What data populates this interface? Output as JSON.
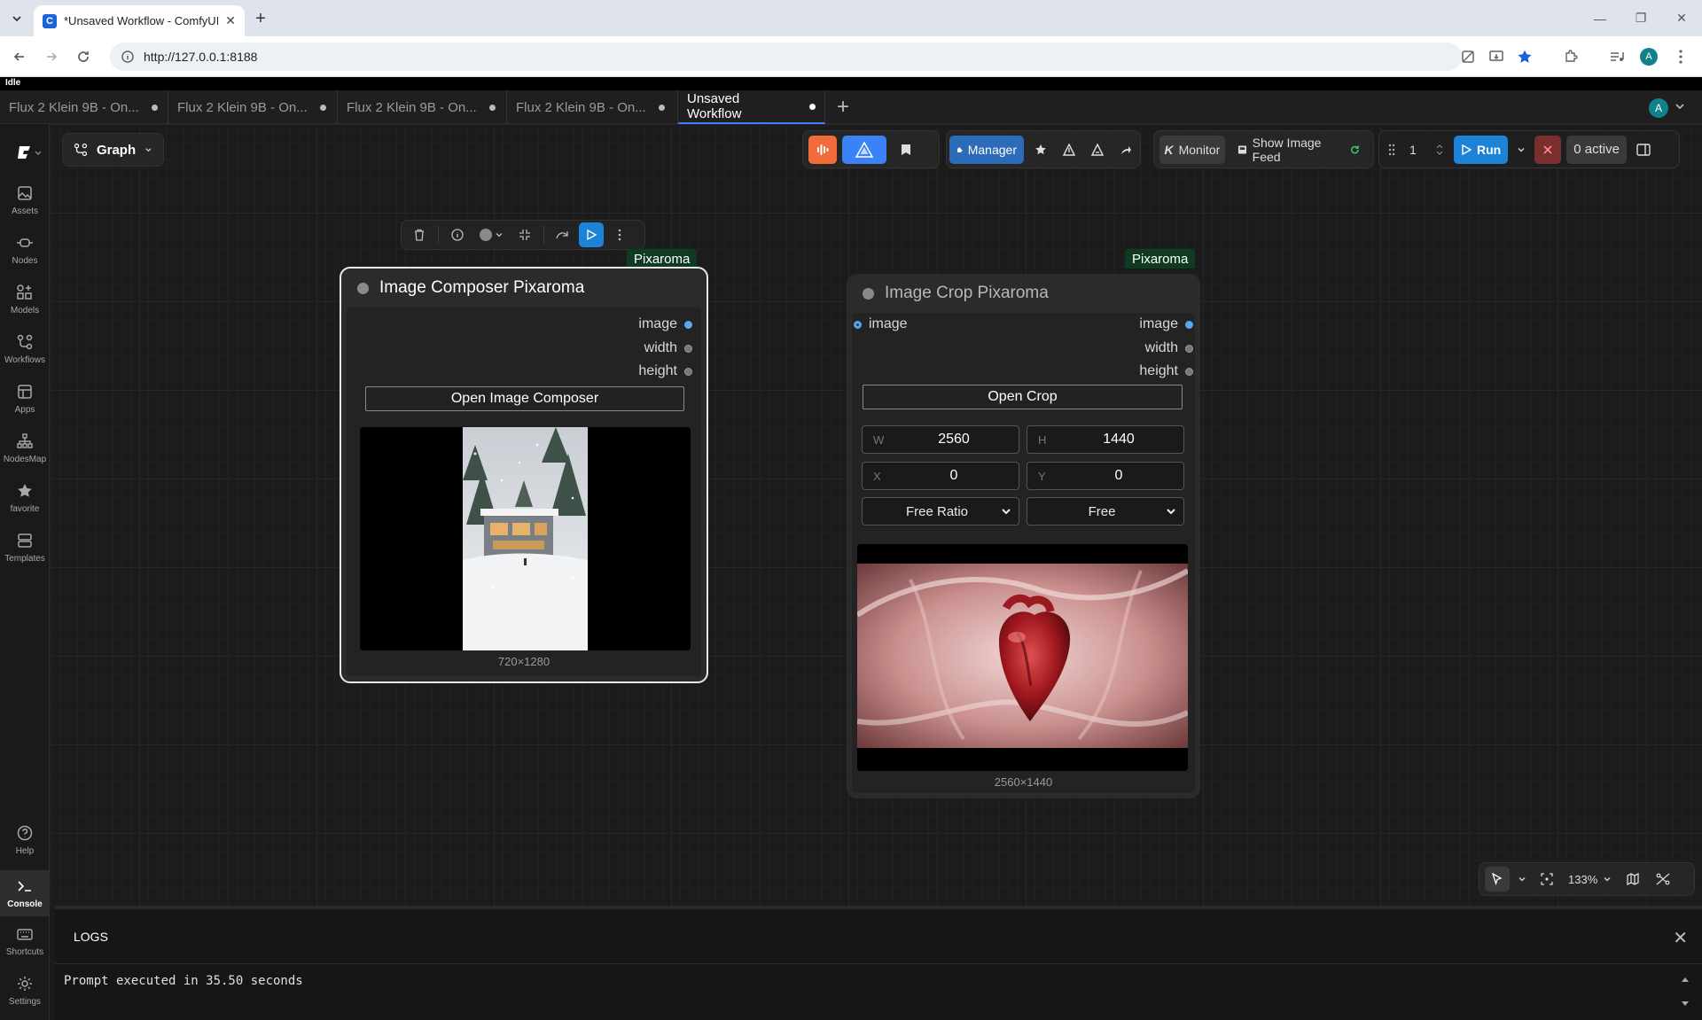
{
  "browser": {
    "tab_title": "*Unsaved Workflow - ComfyUI",
    "favicon_letter": "C",
    "url": "http://127.0.0.1:8188",
    "profile_initial": "A"
  },
  "status": {
    "text": "Idle"
  },
  "workflow_tabs": [
    {
      "label": "Flux 2 Klein 9B - On...",
      "active": false
    },
    {
      "label": "Flux 2 Klein 9B - On...",
      "active": false
    },
    {
      "label": "Flux 2 Klein 9B - On...",
      "active": false
    },
    {
      "label": "Flux 2 Klein 9B - On...",
      "active": false
    },
    {
      "label": "Unsaved Workflow",
      "active": true
    }
  ],
  "user_initial": "A",
  "sidebar": {
    "items": [
      {
        "label": "Assets",
        "icon": "image-icon"
      },
      {
        "label": "Nodes",
        "icon": "node-icon"
      },
      {
        "label": "Models",
        "icon": "models-icon"
      },
      {
        "label": "Workflows",
        "icon": "workflow-icon"
      },
      {
        "label": "Apps",
        "icon": "apps-icon"
      },
      {
        "label": "NodesMap",
        "icon": "nodesmap-icon"
      },
      {
        "label": "favorite",
        "icon": "star-icon"
      },
      {
        "label": "Templates",
        "icon": "templates-icon"
      }
    ],
    "bottom": [
      {
        "label": "Help",
        "icon": "help-icon"
      },
      {
        "label": "Console",
        "icon": "terminal-icon"
      },
      {
        "label": "Shortcuts",
        "icon": "keyboard-icon"
      },
      {
        "label": "Settings",
        "icon": "gear-icon"
      }
    ]
  },
  "graph_menu": {
    "label": "Graph"
  },
  "topbar": {
    "manager_label": "Manager",
    "monitor_label": "Monitor",
    "monitor_prefix": "K",
    "image_feed_label": "Show Image Feed",
    "queue_count": "1",
    "run_label": "Run",
    "active_label": "0 active"
  },
  "nodes": {
    "composer": {
      "title": "Image Composer Pixaroma",
      "badge": "Pixaroma",
      "outputs": [
        "image",
        "width",
        "height"
      ],
      "button": "Open Image Composer",
      "caption": "720×1280"
    },
    "crop": {
      "title": "Image Crop Pixaroma",
      "badge": "Pixaroma",
      "input": "image",
      "outputs": [
        "image",
        "width",
        "height"
      ],
      "button": "Open Crop",
      "w_label": "W",
      "w_value": "2560",
      "h_label": "H",
      "h_value": "1440",
      "x_label": "X",
      "x_value": "0",
      "y_label": "Y",
      "y_value": "0",
      "ratio": "Free Ratio",
      "mode": "Free",
      "caption": "2560×1440"
    }
  },
  "zoom": {
    "level": "133%"
  },
  "logs": {
    "title": "LOGS",
    "line": "Prompt executed in 35.50 seconds"
  }
}
